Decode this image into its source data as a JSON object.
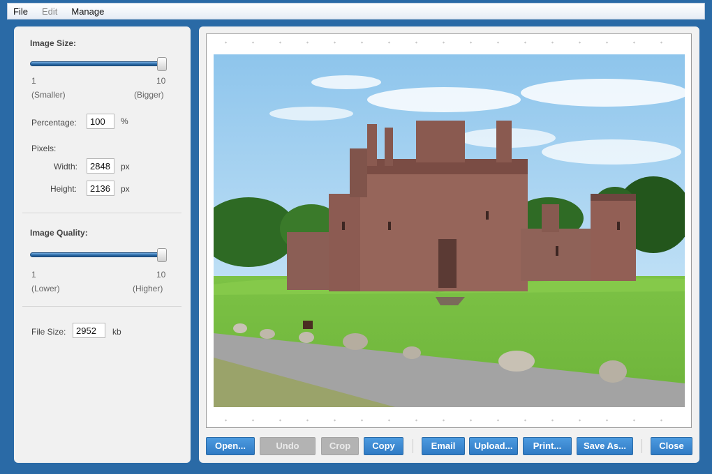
{
  "menu": {
    "file": "File",
    "edit": "Edit",
    "manage": "Manage"
  },
  "image_size": {
    "title": "Image Size:",
    "slider_min": "1",
    "slider_max": "10",
    "slider_value": 10,
    "min_hint": "(Smaller)",
    "max_hint": "(Bigger)",
    "percentage_label": "Percentage:",
    "percentage_value": "100",
    "percentage_unit": "%",
    "pixels_label": "Pixels:",
    "width_label": "Width:",
    "width_value": "2848",
    "height_label": "Height:",
    "height_value": "2136",
    "px_unit": "px"
  },
  "image_quality": {
    "title": "Image Quality:",
    "slider_min": "1",
    "slider_max": "10",
    "slider_value": 10,
    "min_hint": "(Lower)",
    "max_hint": "(Higher)"
  },
  "file_size": {
    "label": "File Size:",
    "value": "2952",
    "unit": "kb"
  },
  "toolbar": {
    "open": "Open...",
    "undo": "Undo",
    "crop": "Crop",
    "copy": "Copy",
    "email": "Email",
    "upload": "Upload...",
    "print": "Print...",
    "save_as": "Save As...",
    "close": "Close"
  },
  "colors": {
    "accent": "#2f7ac4",
    "window_border": "#2a6aa6",
    "disabled_button": "#b3b3b3"
  }
}
